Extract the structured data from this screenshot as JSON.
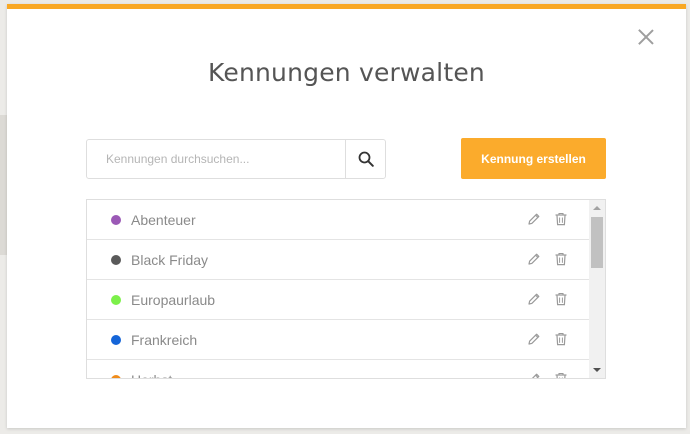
{
  "modal": {
    "title": "Kennungen verwalten",
    "accent_color": "#f9a825"
  },
  "search": {
    "placeholder": "Kennungen durchsuchen...",
    "value": ""
  },
  "create_button": {
    "label": "Kennung erstellen",
    "color": "#fbab2c"
  },
  "tags": [
    {
      "label": "Abenteuer",
      "color": "#9b59b6"
    },
    {
      "label": "Black Friday",
      "color": "#5a5a5a"
    },
    {
      "label": "Europaurlaub",
      "color": "#7cf04a"
    },
    {
      "label": "Frankreich",
      "color": "#1565d8"
    },
    {
      "label": "Herbst",
      "color": "#f08c1a"
    }
  ],
  "icons": {
    "close": "close-icon",
    "search": "search-icon",
    "edit": "pencil-icon",
    "delete": "trash-icon"
  }
}
